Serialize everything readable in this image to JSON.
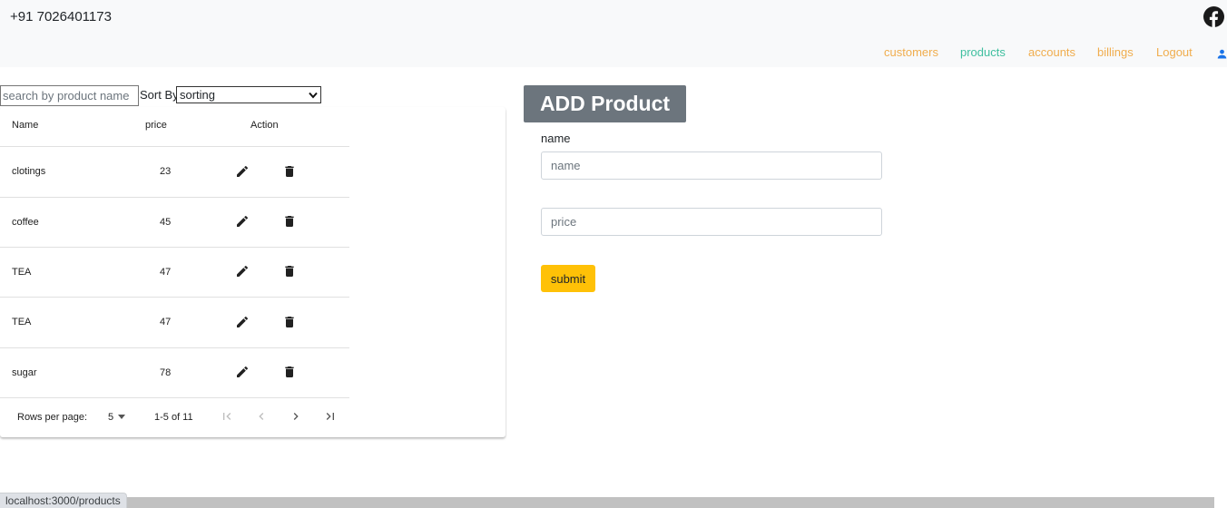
{
  "header": {
    "phone": "+91 7026401173",
    "nav": [
      {
        "label": "customers",
        "color": "#f0ad4e"
      },
      {
        "label": "products",
        "color": "#3fbf9f"
      },
      {
        "label": "accounts",
        "color": "#f0ad4e"
      },
      {
        "label": "billings",
        "color": "#f0ad4e"
      },
      {
        "label": "Logout",
        "color": "#f0ad4e"
      }
    ],
    "icons": {
      "social": "facebook-icon",
      "user": "user-icon"
    }
  },
  "filters": {
    "search_placeholder": "search by product name",
    "search_value": "",
    "sort_label": "Sort By",
    "sort_value": "sorting"
  },
  "table": {
    "columns": [
      "Name",
      "price",
      "Action"
    ],
    "rows": [
      {
        "name": "clotings",
        "price": "23"
      },
      {
        "name": "coffee",
        "price": "45"
      },
      {
        "name": "TEA",
        "price": "47"
      },
      {
        "name": "TEA",
        "price": "47"
      },
      {
        "name": "sugar",
        "price": "78"
      }
    ],
    "row_actions": [
      "edit-icon",
      "delete-icon"
    ],
    "pagination": {
      "rows_per_page_label": "Rows per page:",
      "rows_per_page": "5",
      "range": "1-5 of 11"
    }
  },
  "form": {
    "title": "ADD Product",
    "name_label": "name",
    "name_placeholder": "name",
    "name_value": "",
    "price_placeholder": "price",
    "price_value": "",
    "submit_label": "submit",
    "colors": {
      "title_bg": "#6c757d",
      "submit_bg": "#ffc107"
    }
  },
  "status_bar": {
    "url": "localhost:3000/products"
  }
}
